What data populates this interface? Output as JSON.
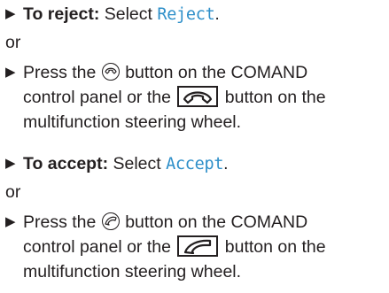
{
  "bullet": "▶",
  "steps": {
    "reject": {
      "lead": "To reject:",
      "text_before": " Select ",
      "softkey": "Reject",
      "text_after": "."
    },
    "reject_alt": {
      "text_before": "Press the ",
      "text_mid_line1": " button on the COMAND",
      "line2_before": "control panel or the ",
      "line2_after": " button on the",
      "line3": "multifunction steering wheel."
    },
    "accept": {
      "lead": "To accept:",
      "text_before": " Select ",
      "softkey": "Accept",
      "text_after": "."
    },
    "accept_alt": {
      "text_before": "Press the ",
      "text_mid_line1": " button on the COMAND",
      "line2_before": "control panel or the ",
      "line2_after": " button on the",
      "line3": "multifunction steering wheel."
    }
  },
  "or_label": "or",
  "icons": {
    "end_call_round": "end-call-icon",
    "end_call_box": "end-call-box-icon",
    "accept_call_round": "accept-call-icon",
    "accept_call_box": "accept-call-box-icon"
  },
  "colors": {
    "softkey": "#2e8fc9",
    "text": "#231f20"
  }
}
